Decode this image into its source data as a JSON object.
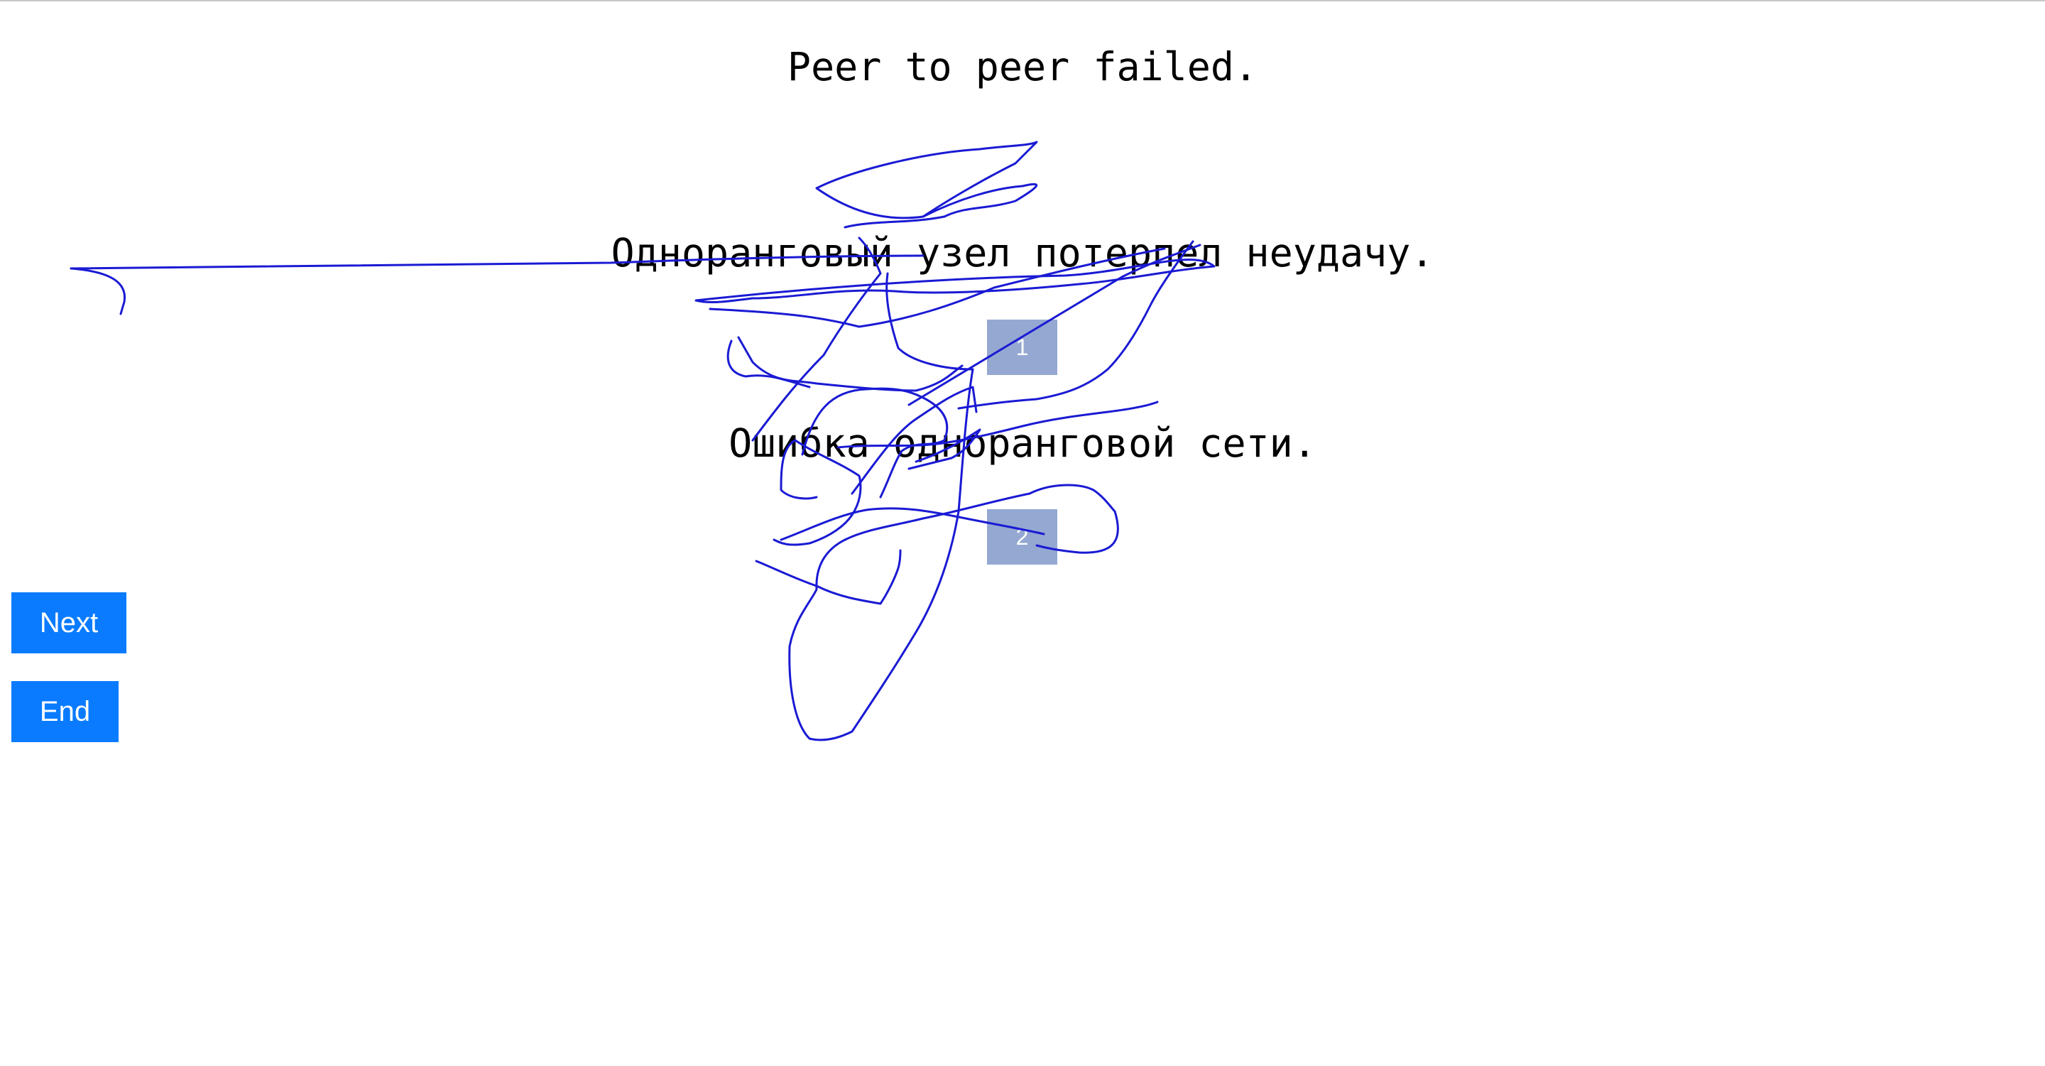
{
  "lines": {
    "english": "Peer to peer failed.",
    "translation_1": "Одноранговый узел потерпел неудачу.",
    "translation_2": "Ошибка одноранговой сети."
  },
  "markers": {
    "first": "1",
    "second": "2"
  },
  "buttons": {
    "next_label": "Next",
    "end_label": "End"
  },
  "colors": {
    "button": "#0a7bff",
    "marker": "#94a8d2",
    "stroke": "#1a1ad4"
  }
}
